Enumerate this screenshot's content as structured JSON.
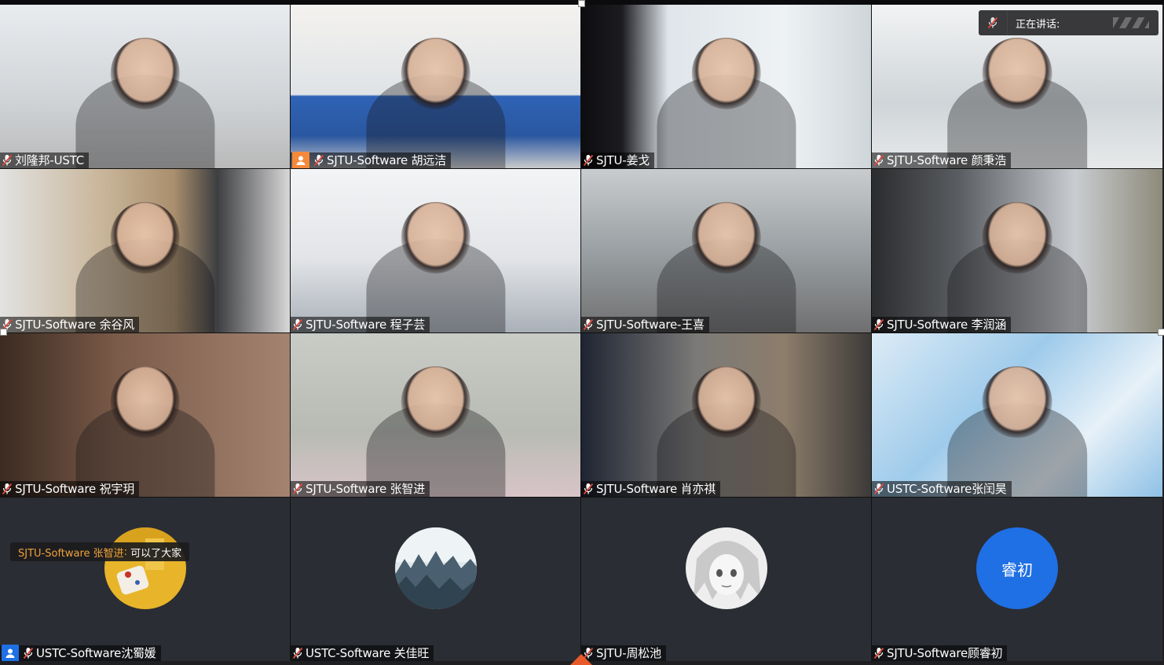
{
  "speaking_indicator": {
    "label": "正在讲话:",
    "icons": [
      "mic-muted-icon",
      "grip-icon"
    ]
  },
  "chat_popup": {
    "sender": "SJTU-Software 张智进",
    "separator": ":",
    "message": "可以了大家"
  },
  "tiles": [
    {
      "name": "刘隆邦-USTC",
      "type": "camera"
    },
    {
      "name": "SJTU-Software 胡远洁",
      "type": "camera",
      "badge": "person-icon",
      "badge_color": "#f5893b"
    },
    {
      "name": "SJTU-姜戈",
      "type": "camera"
    },
    {
      "name": "SJTU-Software 颜秉浩",
      "type": "camera"
    },
    {
      "name": "SJTU-Software 余谷风",
      "type": "camera"
    },
    {
      "name": "SJTU-Software 程子芸",
      "type": "camera"
    },
    {
      "name": "SJTU-Software-王喜",
      "type": "camera"
    },
    {
      "name": "SJTU-Software 李润涵",
      "type": "camera"
    },
    {
      "name": "SJTU-Software 祝宇玥",
      "type": "camera"
    },
    {
      "name": "SJTU-Software 张智进",
      "type": "camera"
    },
    {
      "name": "SJTU-Software 肖亦祺",
      "type": "camera"
    },
    {
      "name": "USTC-Software张闰昊",
      "type": "camera"
    },
    {
      "name": "USTC-Software沈蜀媛",
      "type": "avatar",
      "avatar": "photo-avatar-yellow",
      "badge": "person-icon",
      "badge_color": "#1f6fe5"
    },
    {
      "name": "USTC-Software 关佳旺",
      "type": "avatar",
      "avatar": "photo-avatar-forest"
    },
    {
      "name": "SJTU-周松池",
      "type": "avatar",
      "avatar": "photo-avatar-anime"
    },
    {
      "name": "SJTU-Software顾睿初",
      "type": "avatar",
      "avatar_text": "睿初",
      "avatar_color": "#1f6fe5"
    }
  ],
  "colors": {
    "accent_blue": "#1f6fe5",
    "host_orange": "#f5893b",
    "chat_sender": "#f0a23a",
    "muted_red": "#e0483b"
  }
}
